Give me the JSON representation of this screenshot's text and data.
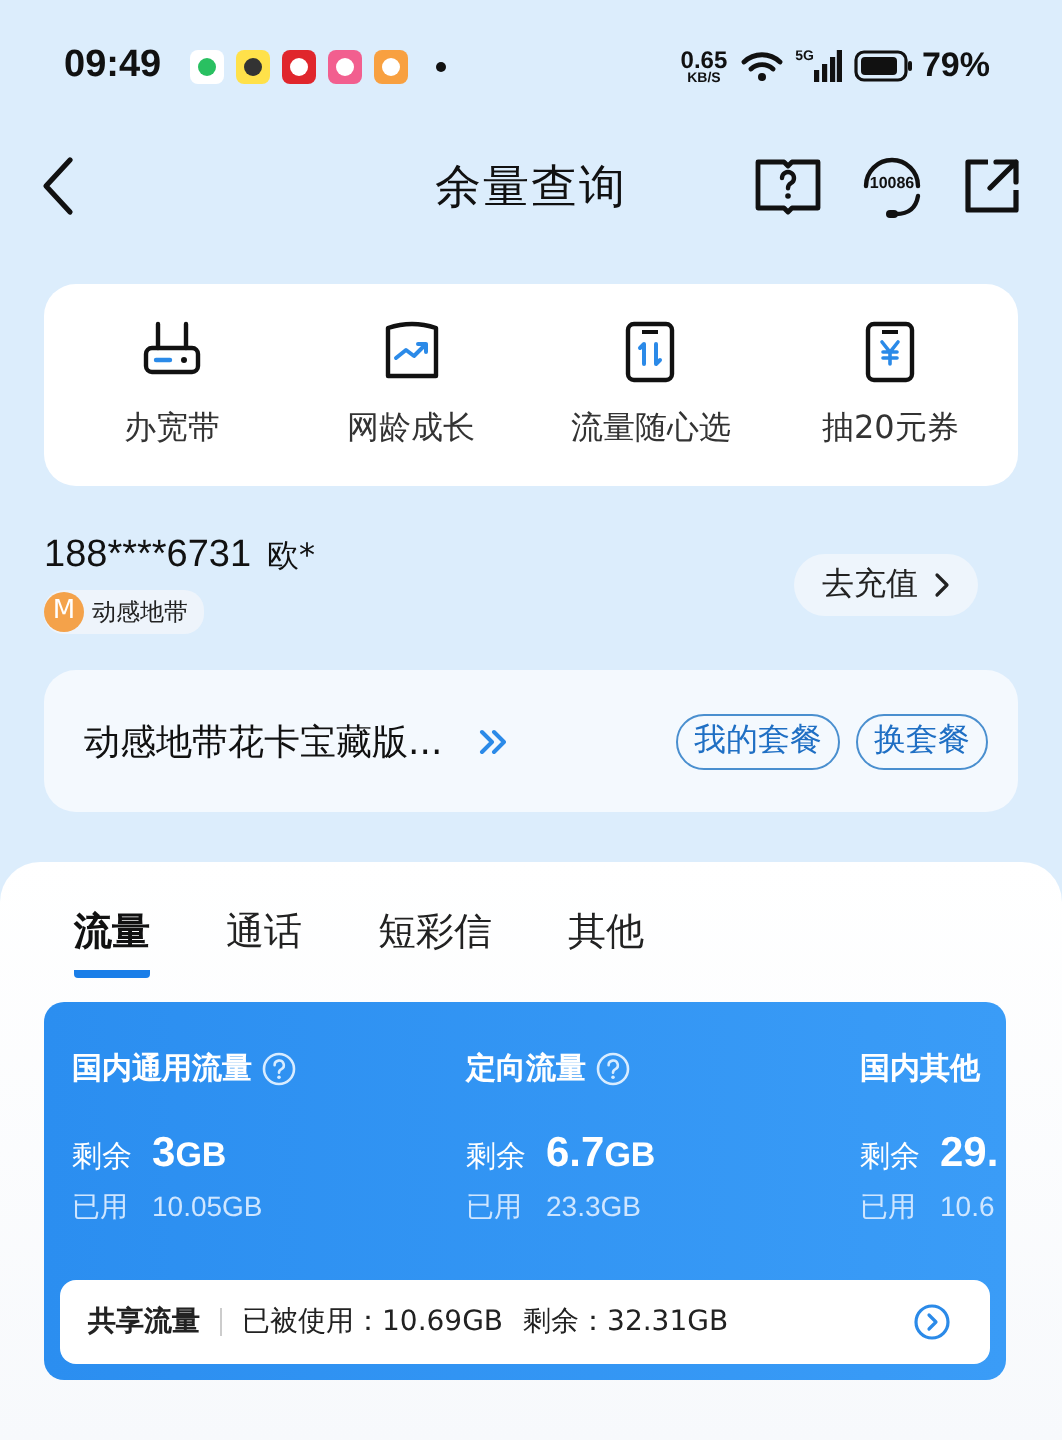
{
  "status_bar": {
    "time": "09:49",
    "speed": "0.65",
    "speed_unit": "KB/S",
    "network": "5G",
    "battery": "79%"
  },
  "nav": {
    "title": "余量查询",
    "hotline": "10086"
  },
  "quick_actions": [
    {
      "label": "办宽带",
      "kind": "router"
    },
    {
      "label": "网龄成长",
      "kind": "growth"
    },
    {
      "label": "流量随心选",
      "kind": "data"
    },
    {
      "label": "抽20元券",
      "kind": "coupon"
    }
  ],
  "account": {
    "phone": "188****6731",
    "name": "欧*",
    "badge_letter": "M",
    "brand": "动感地带",
    "recharge": "去充值"
  },
  "plan": {
    "name": "动感地带花卡宝藏版...",
    "buttons": [
      "我的套餐",
      "换套餐"
    ]
  },
  "tabs": [
    {
      "label": "流量",
      "selected": true
    },
    {
      "label": "通话",
      "selected": false
    },
    {
      "label": "短彩信",
      "selected": false
    },
    {
      "label": "其他",
      "selected": false
    }
  ],
  "usage": [
    {
      "title": "国内通用流量",
      "help": true,
      "remaining_label": "剩余",
      "remaining_value": "3",
      "remaining_unit": "GB",
      "used_label": "已用",
      "used_value": "10.05GB"
    },
    {
      "title": "定向流量",
      "help": true,
      "remaining_label": "剩余",
      "remaining_value": "6.7",
      "remaining_unit": "GB",
      "used_label": "已用",
      "used_value": "23.3GB"
    },
    {
      "title": "国内其他",
      "help": false,
      "remaining_label": "剩余",
      "remaining_value": "29.",
      "used_label": "已用",
      "used_value": "10.6"
    }
  ],
  "shared": {
    "label": "共享流量",
    "used": "已被使用：10.69GB",
    "remaining": "剩余：32.31GB"
  }
}
